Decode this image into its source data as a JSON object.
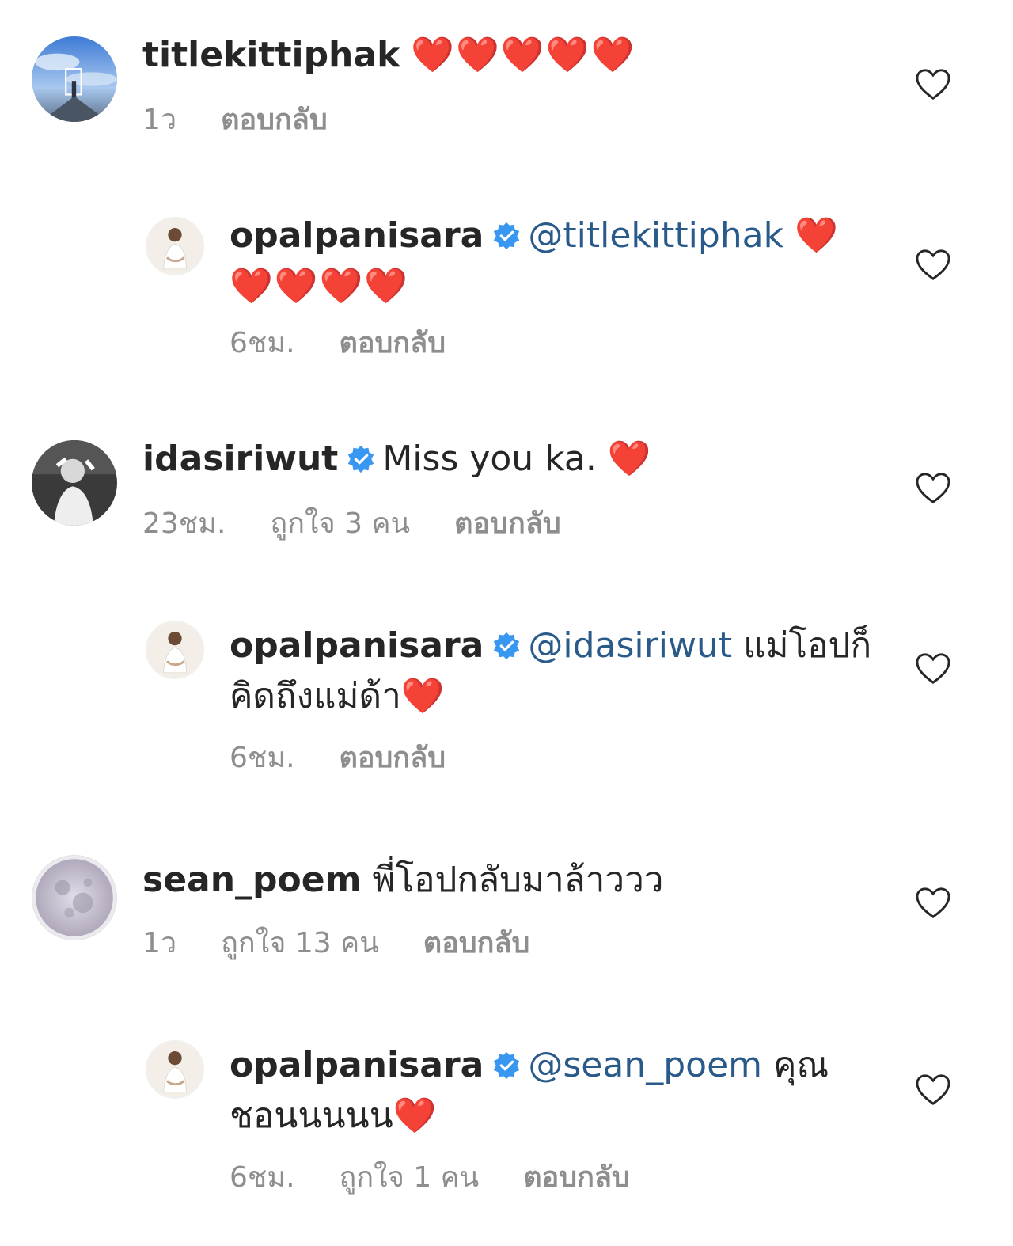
{
  "comments": [
    {
      "username": "titlekittiphak",
      "verified": false,
      "mention": "",
      "text": "",
      "hearts": "❤️❤️❤️❤️❤️",
      "time": "1ว",
      "likes": "",
      "reply_label": "ตอบกลับ"
    },
    {
      "username": "opalpanisara",
      "verified": true,
      "mention": "@titlekittiphak",
      "text": "",
      "hearts": "❤️❤️❤️❤️❤️",
      "time": "6ชม.",
      "likes": "",
      "reply_label": "ตอบกลับ"
    },
    {
      "username": "idasiriwut",
      "verified": true,
      "mention": "",
      "text": "Miss you ka.",
      "hearts": "❤️",
      "time": "23ชม.",
      "likes": "ถูกใจ 3 คน",
      "reply_label": "ตอบกลับ"
    },
    {
      "username": "opalpanisara",
      "verified": true,
      "mention": "@idasiriwut",
      "text": "แม่โอปก็คิดถึงแม่ด้า",
      "hearts": "❤️",
      "time": "6ชม.",
      "likes": "",
      "reply_label": "ตอบกลับ"
    },
    {
      "username": "sean_poem",
      "verified": false,
      "mention": "",
      "text": "พี่โอปกลับมาล้าววว",
      "hearts": "",
      "time": "1ว",
      "likes": "ถูกใจ 13 คน",
      "reply_label": "ตอบกลับ"
    },
    {
      "username": "opalpanisara",
      "verified": true,
      "mention": "@sean_poem",
      "text": "คุณชอนนนนน",
      "hearts": "❤️",
      "time": "6ชม.",
      "likes": "ถูกใจ 1 คน",
      "reply_label": "ตอบกลับ"
    }
  ],
  "colors": {
    "verified_badge": "#3897f0",
    "mention": "#2a5a8a",
    "meta_text": "#8e8e8e",
    "heart": "#e0171b"
  },
  "icons": {
    "like": "heart-outline-icon",
    "verified": "verified-badge-icon"
  }
}
